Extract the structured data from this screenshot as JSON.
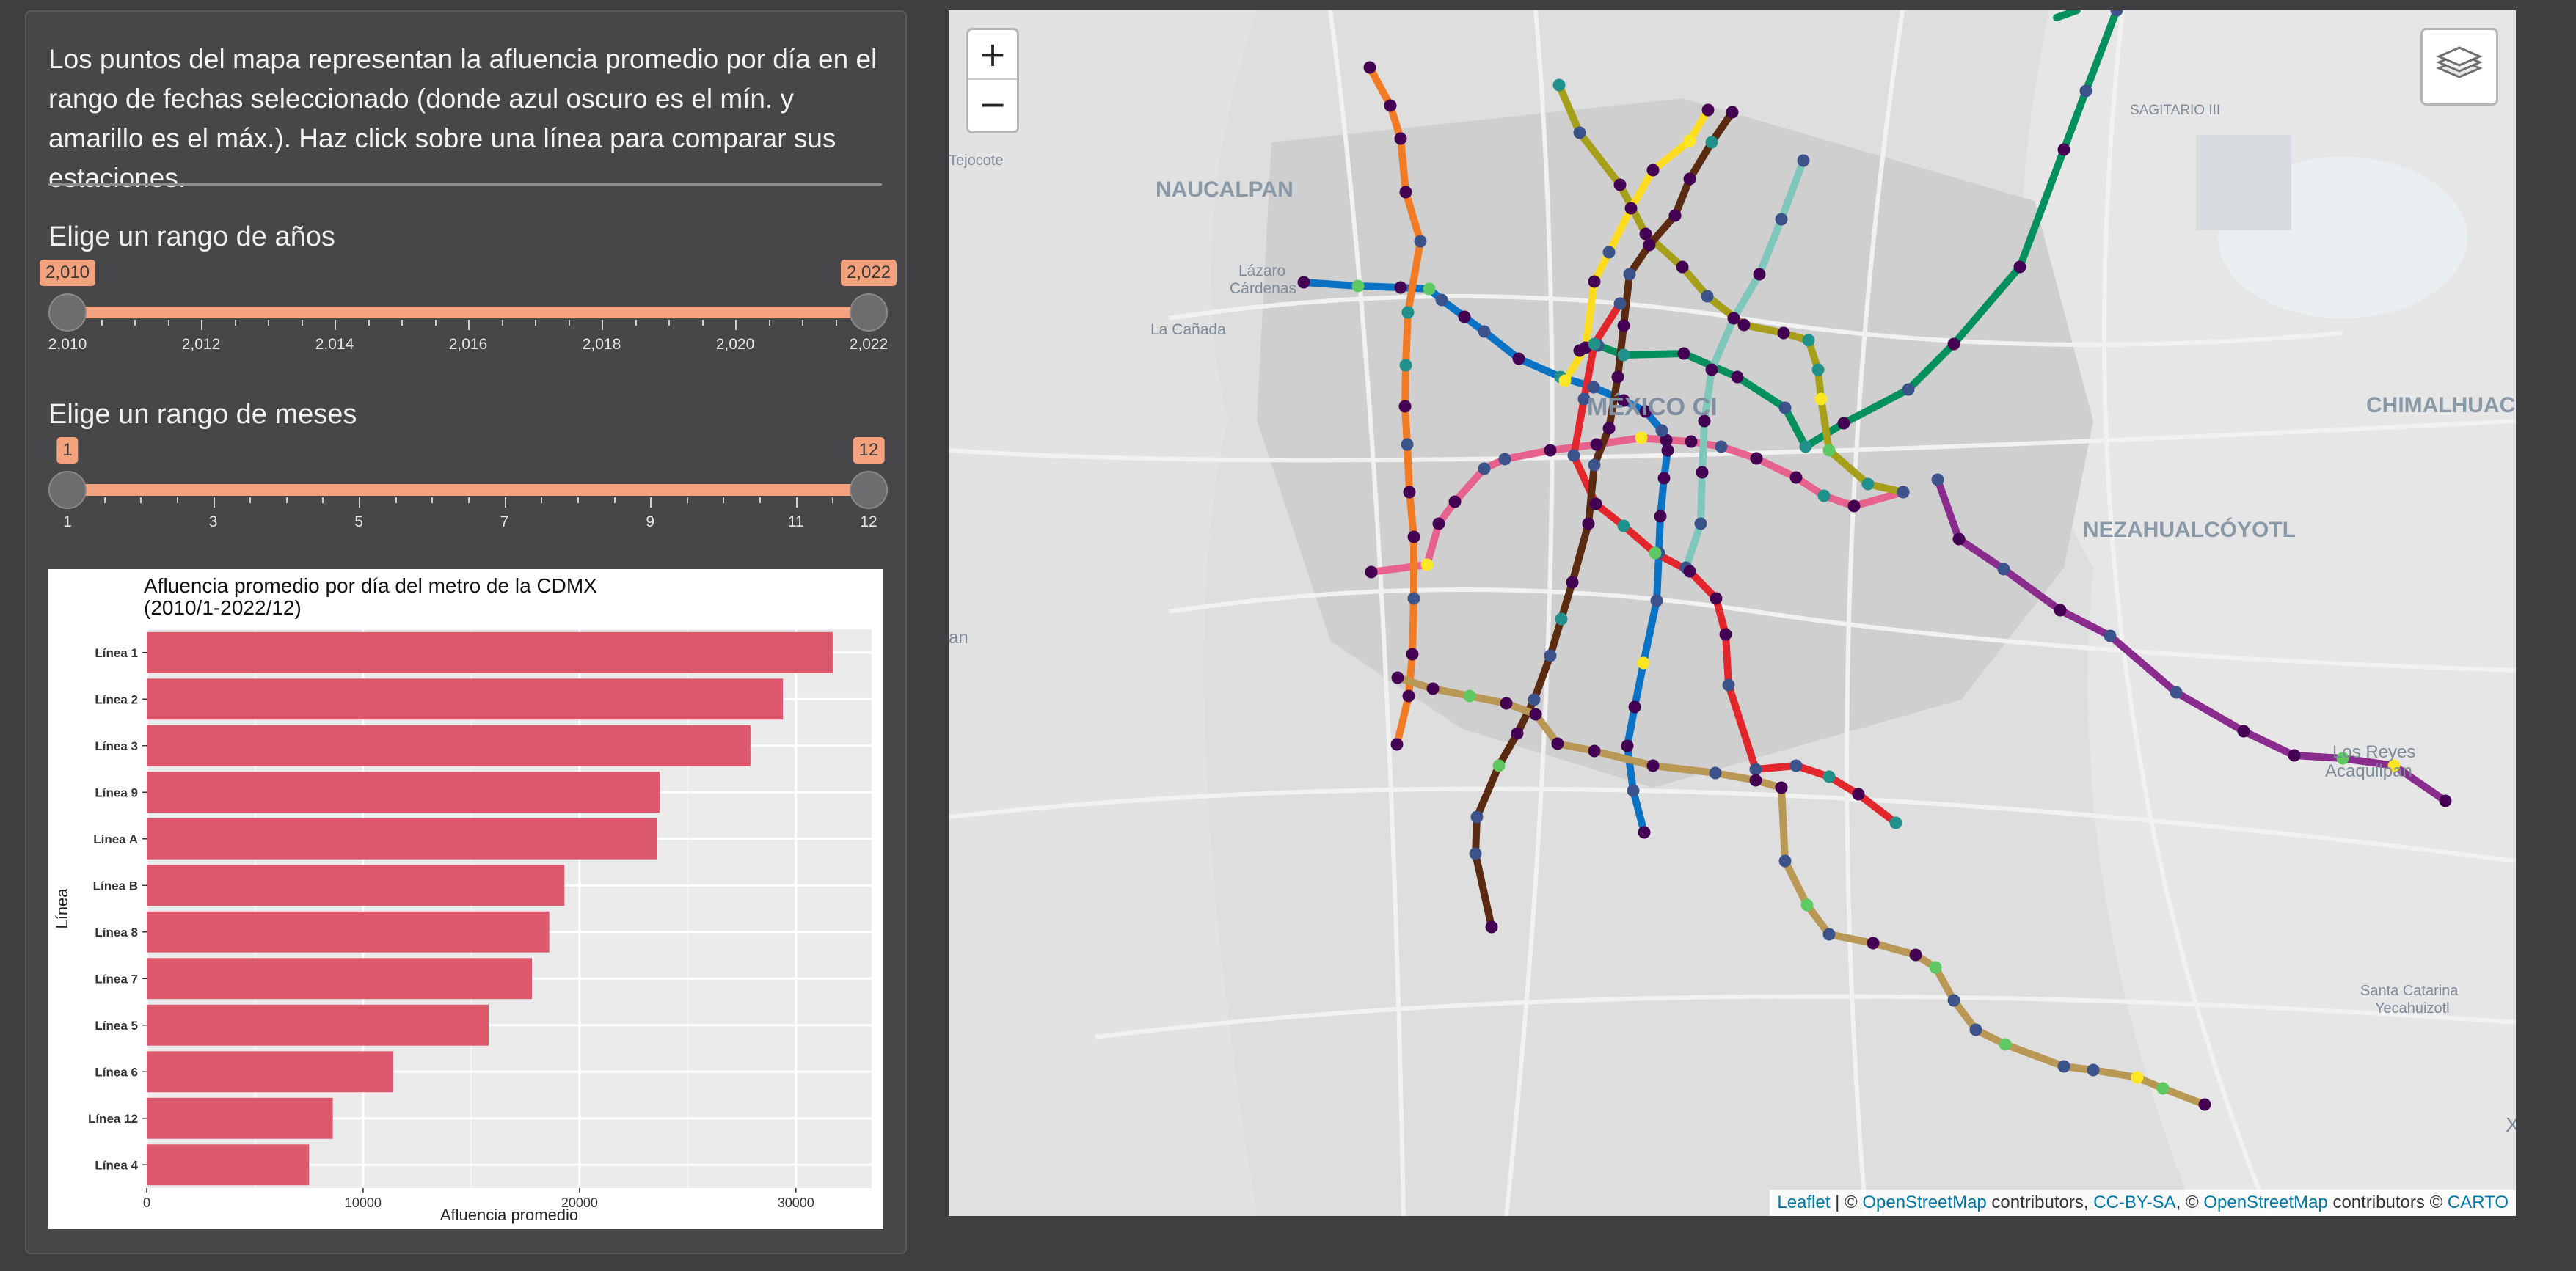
{
  "sidebar": {
    "description": "Los puntos del mapa representan la afluencia promedio por día en el rango de fechas seleccionado (donde azul oscuro es el mín. y amarillo es el máx.). Haz click sobre una línea para comparar sus estaciones.",
    "years": {
      "label": "Elige un rango de años",
      "min_label": "2,010",
      "max_label": "2,022",
      "from": 2010,
      "to": 2022,
      "ticks": [
        "2,010",
        "2,012",
        "2,014",
        "2,016",
        "2,018",
        "2,020",
        "2,022"
      ]
    },
    "months": {
      "label": "Elige un rango de meses",
      "min_label": "1",
      "max_label": "12",
      "from": 1,
      "to": 12,
      "ticks": [
        "1",
        "3",
        "5",
        "7",
        "9",
        "11",
        "12"
      ]
    }
  },
  "chart_data": {
    "type": "bar",
    "orientation": "horizontal",
    "title": "Afluencia promedio por día del metro de la CDMX",
    "subtitle": "(2010/1-2022/12)",
    "xlabel": "Afluencia promedio",
    "ylabel": "Línea",
    "categories": [
      "Línea 1",
      "Línea 2",
      "Línea 3",
      "Línea 9",
      "Línea A",
      "Línea B",
      "Línea 8",
      "Línea 7",
      "Línea 5",
      "Línea 6",
      "Línea 12",
      "Línea 4"
    ],
    "values": [
      31700,
      29400,
      27900,
      23700,
      23600,
      19300,
      18600,
      17800,
      15800,
      11400,
      8600,
      7500
    ],
    "xlim": [
      0,
      33500
    ],
    "xticks": [
      "0",
      "10000",
      "20000",
      "30000"
    ],
    "xtick_values": [
      0,
      10000,
      20000,
      30000
    ],
    "bar_color": "#dc586c",
    "grid": true
  },
  "map": {
    "zoom_in": "+",
    "zoom_out": "−",
    "layers_icon": "layers-icon",
    "places": [
      "NAUCALPAN",
      "Tejocote",
      "Lázaro",
      "Cárdenas",
      "La Cañada",
      "MÉXICO CI",
      "SAGITARIO III",
      "CHIMALHUAC",
      "NEZAHUALCÓYOTL",
      "Los Reyes",
      "Acaquilpan",
      "Santa Catarina",
      "Yecahuizotl",
      "an",
      "X"
    ],
    "attribution": {
      "leaflet": "Leaflet",
      "sep": " | © ",
      "osm": "OpenStreetMap",
      "contrib": " contributors, ",
      "ccbysa": "CC-BY-SA",
      "comma": ", © ",
      "osm2": "OpenStreetMap",
      "contrib2": " contributors © ",
      "carto": "CARTO"
    },
    "station_scale": [
      "#440154",
      "#3b528b",
      "#21918c",
      "#5ec962",
      "#fde725"
    ],
    "lines": [
      {
        "name": "Línea 1",
        "color": "#e8628e"
      },
      {
        "name": "Línea 2",
        "color": "#0b73c5"
      },
      {
        "name": "Línea 3",
        "color": "#a59f1a"
      },
      {
        "name": "Línea 4",
        "color": "#7fc7bb"
      },
      {
        "name": "Línea 5",
        "color": "#fddb1f"
      },
      {
        "name": "Línea 6",
        "color": "#e3262b"
      },
      {
        "name": "Línea 7",
        "color": "#f27b24"
      },
      {
        "name": "Línea 8",
        "color": "#03905c"
      },
      {
        "name": "Línea 9",
        "color": "#5a2b10"
      },
      {
        "name": "Línea A",
        "color": "#8a2b8e"
      },
      {
        "name": "Línea B",
        "color": "#03905c"
      },
      {
        "name": "Línea 12",
        "color": "#b99856"
      }
    ]
  }
}
